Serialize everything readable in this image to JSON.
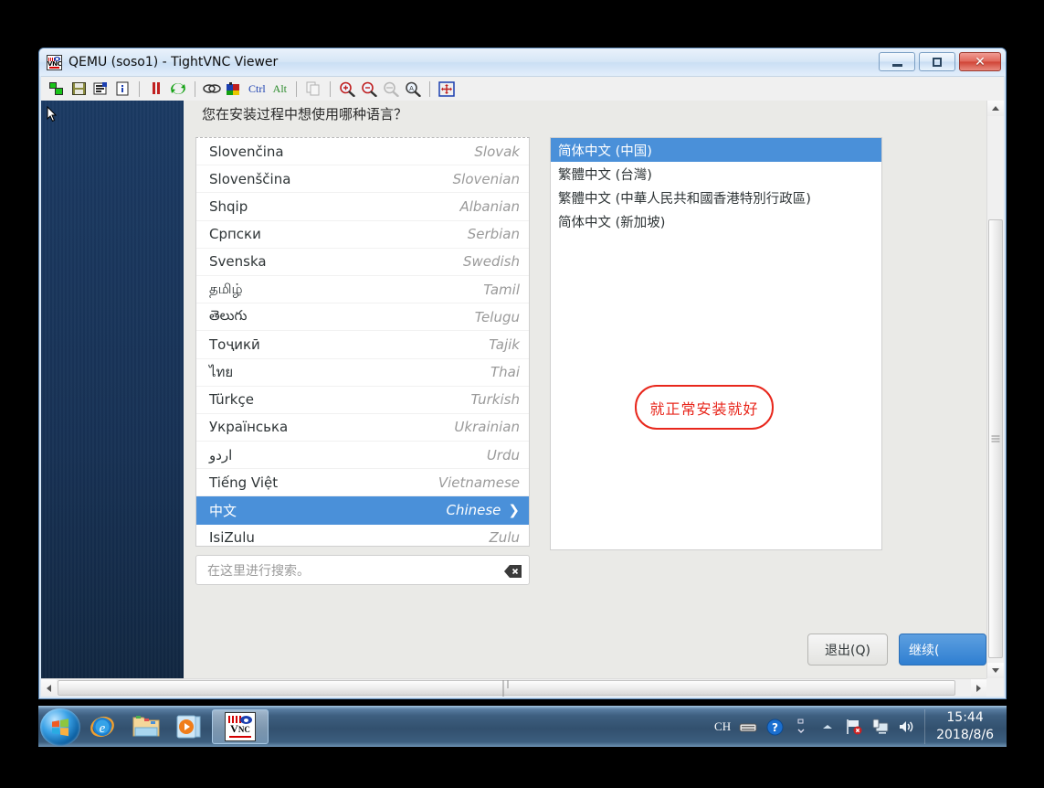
{
  "window": {
    "title": "QEMU (soso1) - TightVNC Viewer",
    "title_icon": "vnc-logo-icon",
    "controls": {
      "minimize": "minimize-icon",
      "restore": "restore-icon",
      "close": "close-icon"
    }
  },
  "toolbar": {
    "items": [
      {
        "name": "new-connection-icon",
        "label": ""
      },
      {
        "name": "save-connection-icon",
        "label": ""
      },
      {
        "name": "connection-options-icon",
        "label": ""
      },
      {
        "name": "connection-info-icon",
        "label": ""
      },
      {
        "name": "pause-icon",
        "label": ""
      },
      {
        "name": "refresh-icon",
        "label": ""
      },
      {
        "name": "send-keys-icon",
        "label": ""
      },
      {
        "name": "send-ctrl-alt-del-icon",
        "label": ""
      },
      {
        "name": "ctrl-key-button",
        "label": "Ctrl"
      },
      {
        "name": "alt-key-button",
        "label": "Alt"
      },
      {
        "name": "clipboard-icon",
        "label": ""
      },
      {
        "name": "zoom-in-icon",
        "label": ""
      },
      {
        "name": "zoom-out-icon",
        "label": ""
      },
      {
        "name": "zoom-100-icon",
        "label": ""
      },
      {
        "name": "zoom-auto-icon",
        "label": ""
      },
      {
        "name": "fullscreen-icon",
        "label": ""
      }
    ]
  },
  "installer": {
    "prompt": "您在安装过程中想使用哪种语言？",
    "languages": [
      {
        "native": "Slovenčina",
        "english": "Slovak",
        "selected": false
      },
      {
        "native": "Slovenščina",
        "english": "Slovenian",
        "selected": false
      },
      {
        "native": "Shqip",
        "english": "Albanian",
        "selected": false
      },
      {
        "native": "Српски",
        "english": "Serbian",
        "selected": false
      },
      {
        "native": "Svenska",
        "english": "Swedish",
        "selected": false
      },
      {
        "native": "தமிழ்",
        "english": "Tamil",
        "selected": false
      },
      {
        "native": "తెలుగు",
        "english": "Telugu",
        "selected": false
      },
      {
        "native": "Тоҷикӣ",
        "english": "Tajik",
        "selected": false
      },
      {
        "native": "ไทย",
        "english": "Thai",
        "selected": false
      },
      {
        "native": "Türkçe",
        "english": "Turkish",
        "selected": false
      },
      {
        "native": "Українська",
        "english": "Ukrainian",
        "selected": false
      },
      {
        "native": "اردو",
        "english": "Urdu",
        "selected": false
      },
      {
        "native": "Tiếng Việt",
        "english": "Vietnamese",
        "selected": false
      },
      {
        "native": "中文",
        "english": "Chinese",
        "selected": true
      },
      {
        "native": "IsiZulu",
        "english": "Zulu",
        "selected": false
      }
    ],
    "search": {
      "placeholder": "在这里进行搜索。",
      "value": "",
      "clear_icon": "clear-backspace-icon"
    },
    "variants": [
      {
        "label": "简体中文 (中国)",
        "selected": true
      },
      {
        "label": "繁體中文 (台灣)",
        "selected": false
      },
      {
        "label": "繁體中文 (中華人民共和國香港特別行政區)",
        "selected": false
      },
      {
        "label": "简体中文 (新加坡)",
        "selected": false
      }
    ],
    "annotation": {
      "text": "就正常安装就好",
      "color": "#e8271c"
    },
    "buttons": {
      "quit": "退出(Q)",
      "continue": "继续(",
      "accent": "#2f7fd1"
    },
    "selection_color": "#4a90d9"
  },
  "taskbar": {
    "start": "windows-start-orb-icon",
    "apps": [
      {
        "name": "internet-explorer-icon",
        "active": false
      },
      {
        "name": "windows-explorer-icon",
        "active": false
      },
      {
        "name": "windows-media-player-icon",
        "active": false
      },
      {
        "name": "tightvnc-viewer-icon",
        "active": true
      }
    ],
    "tray": {
      "language": "CH",
      "icons": [
        "keyboard-icon",
        "help-icon",
        "show-hidden-icons-icon",
        "network-flag-icon",
        "display-icon",
        "volume-icon"
      ]
    },
    "clock": {
      "time": "15:44",
      "date": "2018/8/6"
    }
  }
}
